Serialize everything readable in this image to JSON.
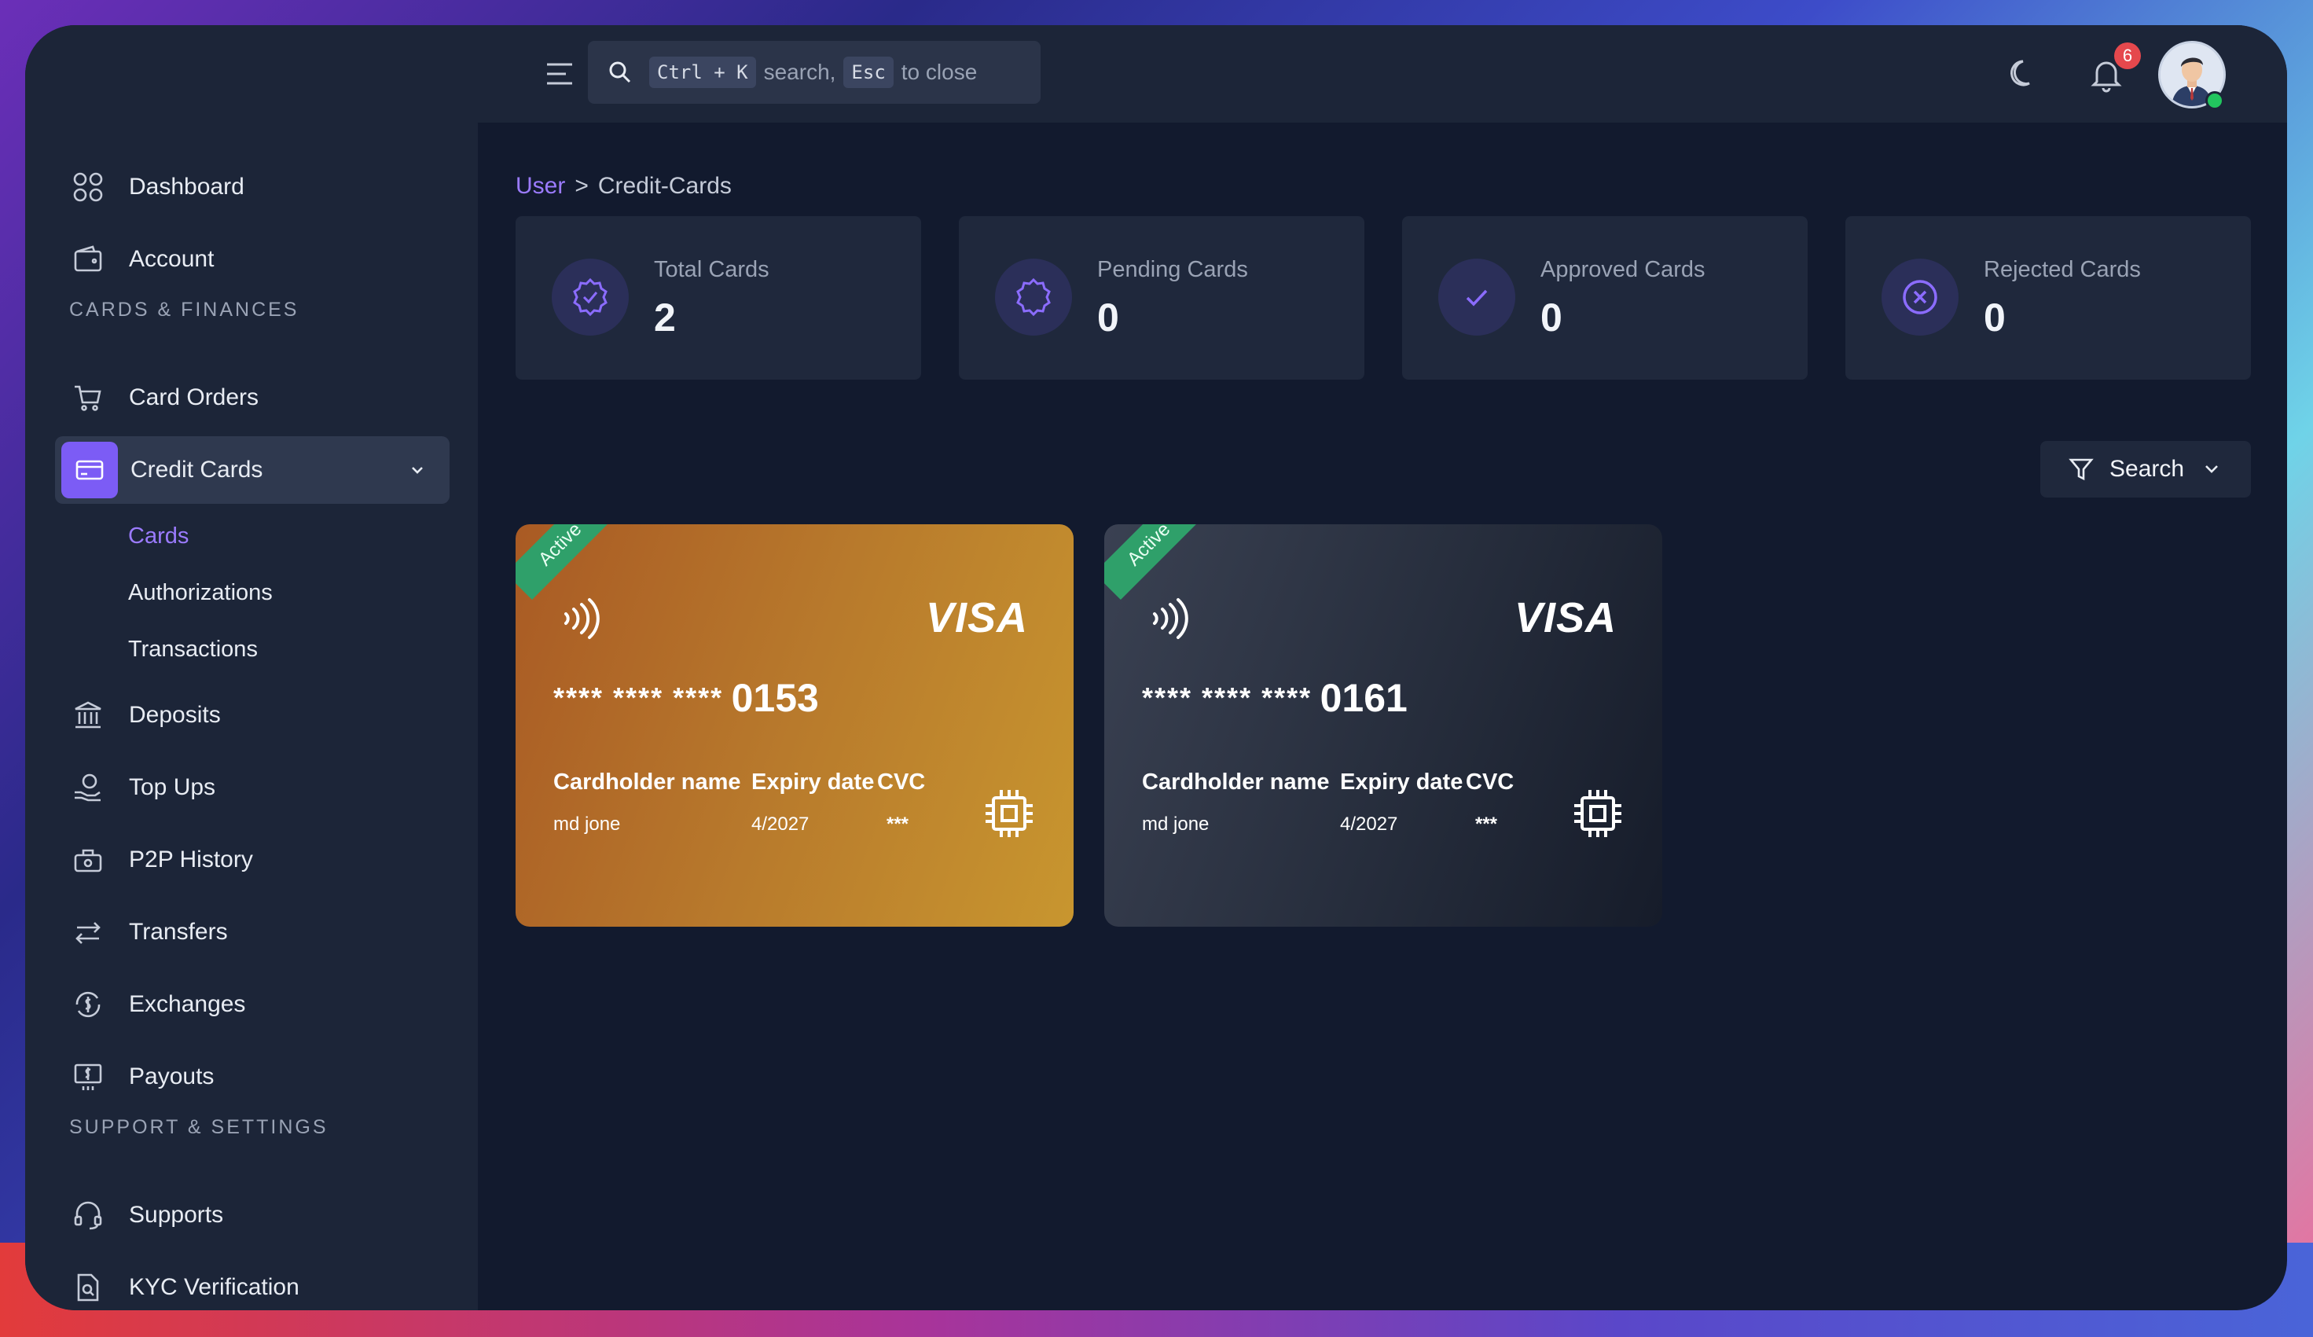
{
  "topbar": {
    "search_kbd1": "Ctrl + K",
    "search_text1": "search,",
    "search_kbd2": "Esc",
    "search_text2": "to close",
    "notification_count": "6"
  },
  "sidebar": {
    "items_top": [
      {
        "label": "Dashboard",
        "icon": "dashboard-icon"
      },
      {
        "label": "Account",
        "icon": "wallet-icon"
      }
    ],
    "section1": "CARDS & FINANCES",
    "card_orders": "Card Orders",
    "credit_cards": "Credit Cards",
    "sub_items": [
      "Cards",
      "Authorizations",
      "Transactions"
    ],
    "items_mid": [
      "Deposits",
      "Top Ups",
      "P2P History",
      "Transfers",
      "Exchanges",
      "Payouts"
    ],
    "section2": "SUPPORT & SETTINGS",
    "items_bottom": [
      "Supports",
      "KYC Verification"
    ]
  },
  "breadcrumb": {
    "root": "User",
    "separator": ">",
    "current": "Credit-Cards"
  },
  "stats": [
    {
      "label": "Total Cards",
      "value": "2"
    },
    {
      "label": "Pending Cards",
      "value": "0"
    },
    {
      "label": "Approved Cards",
      "value": "0"
    },
    {
      "label": "Rejected Cards",
      "value": "0"
    }
  ],
  "filter": {
    "label": "Search"
  },
  "cards": [
    {
      "status": "Active",
      "brand": "VISA",
      "masked": "**** **** ****",
      "last4": "0153",
      "holder_label": "Cardholder name",
      "expiry_label": "Expiry date",
      "cvc_label": "CVC",
      "holder": "md jone",
      "expiry": "4/2027",
      "cvc": "***"
    },
    {
      "status": "Active",
      "brand": "VISA",
      "masked": "**** **** ****",
      "last4": "0161",
      "holder_label": "Cardholder name",
      "expiry_label": "Expiry date",
      "cvc_label": "CVC",
      "holder": "md jone",
      "expiry": "4/2027",
      "cvc": "***"
    }
  ],
  "colors": {
    "accent": "#7c5cf5",
    "active_badge": "#2fa06a",
    "notification": "#e5484d"
  }
}
